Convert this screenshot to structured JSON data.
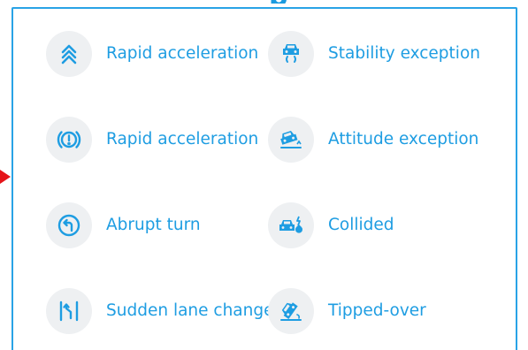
{
  "header": {
    "title_fragment": "p"
  },
  "events": {
    "left": [
      {
        "label": "Rapid acceleration",
        "icon": "chevrons-up-icon"
      },
      {
        "label": "Rapid acceleration",
        "icon": "brake-warning-icon"
      },
      {
        "label": "Abrupt turn",
        "icon": "turn-arrow-icon"
      },
      {
        "label": "Sudden lane change",
        "icon": "lane-change-icon"
      }
    ],
    "right": [
      {
        "label": "Stability exception",
        "icon": "car-skid-icon"
      },
      {
        "label": "Attitude exception",
        "icon": "car-tilt-icon"
      },
      {
        "label": "Collided",
        "icon": "car-collision-icon"
      },
      {
        "label": "Tipped-over",
        "icon": "car-rollover-icon"
      }
    ]
  },
  "colors": {
    "accent": "#1e9de2",
    "border": "#29a3e6",
    "icon_bg": "#eef0f2",
    "pointer": "#e5141a"
  }
}
